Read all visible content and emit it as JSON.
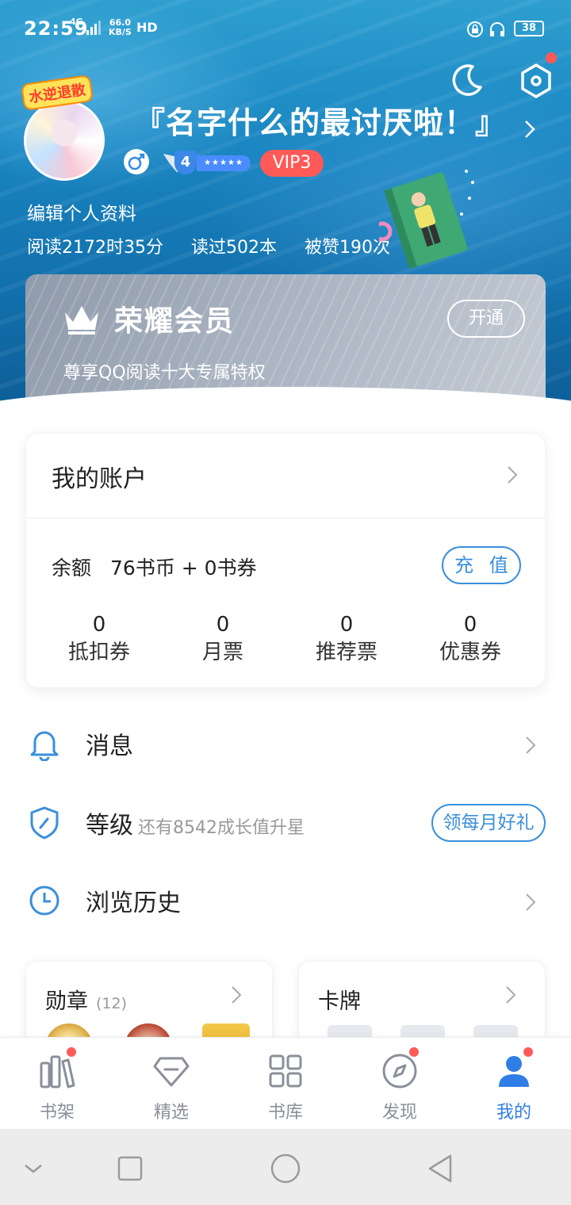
{
  "status_bar": {
    "time": "22:59",
    "network": "4G",
    "speed_value": "66.0",
    "speed_unit": "KB/S",
    "hd": "HD",
    "battery": "38"
  },
  "profile": {
    "avatar_badge": "水逆退散",
    "nickname": "『名字什么的最讨厌啦！』",
    "level": "4",
    "level_stars": "★★★★★",
    "vip": "VIP3",
    "edit_label": "编辑个人资料",
    "stats": {
      "read_time": "阅读2172时35分",
      "books_read": "读过502本",
      "likes": "被赞190次"
    }
  },
  "membership": {
    "title": "荣耀会员",
    "description": "尊享QQ阅读十大专属特权",
    "button": "开通"
  },
  "account": {
    "title": "我的账户",
    "balance_label": "余额",
    "balance_value": "76书币 + 0书券",
    "recharge": "充 值",
    "tickets": [
      {
        "value": "0",
        "label": "抵扣券"
      },
      {
        "value": "0",
        "label": "月票"
      },
      {
        "value": "0",
        "label": "推荐票"
      },
      {
        "value": "0",
        "label": "优惠券"
      }
    ]
  },
  "menu": {
    "messages": {
      "label": "消息"
    },
    "level": {
      "label": "等级",
      "sub": "还有8542成长值升星",
      "button": "领每月好礼"
    },
    "history": {
      "label": "浏览历史"
    }
  },
  "cards": {
    "medals": {
      "title": "勋章",
      "count": "(12)"
    },
    "cards": {
      "title": "卡牌"
    }
  },
  "tabs": [
    {
      "label": "书架",
      "icon": "bookshelf-icon",
      "dot": true
    },
    {
      "label": "精选",
      "icon": "diamond-icon",
      "dot": false
    },
    {
      "label": "书库",
      "icon": "grid-icon",
      "dot": false
    },
    {
      "label": "发现",
      "icon": "compass-icon",
      "dot": true
    },
    {
      "label": "我的",
      "icon": "user-icon",
      "dot": true,
      "active": true
    }
  ],
  "colors": {
    "accent": "#2f7ee6",
    "vip": "#ff5a57",
    "notification_dot": "#ff5a5a",
    "header_blue": "#1a86c2"
  }
}
